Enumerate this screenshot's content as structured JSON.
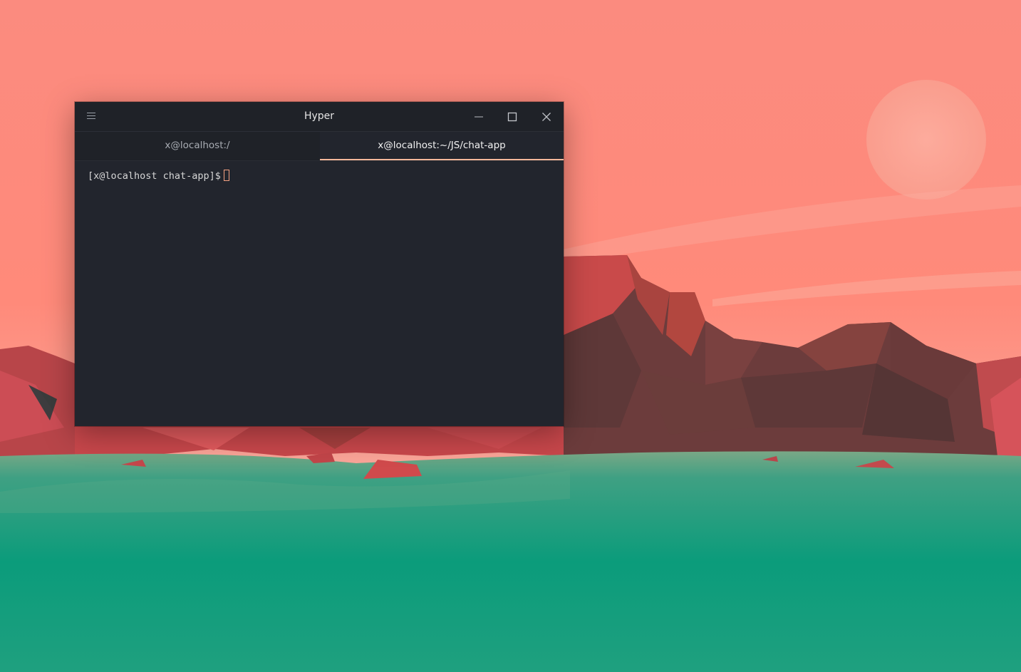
{
  "window": {
    "title": "Hyper",
    "controls": {
      "minimize_icon": "minimize-icon",
      "maximize_icon": "maximize-icon",
      "close_icon": "close-icon"
    },
    "menu_icon": "hamburger-menu-icon"
  },
  "tabs": [
    {
      "label": "x@localhost:/",
      "active": false
    },
    {
      "label": "x@localhost:~/JS/chat-app",
      "active": true
    }
  ],
  "terminal": {
    "prompt": "[x@localhost chat-app]$ ",
    "input": ""
  },
  "colors": {
    "terminal_bg": "#22252d",
    "titlebar_bg": "#1f2228",
    "accent": "#f5b89b",
    "cursor": "#f5a282",
    "sky_top": "#fb8a7e",
    "water": "#06a07f"
  }
}
